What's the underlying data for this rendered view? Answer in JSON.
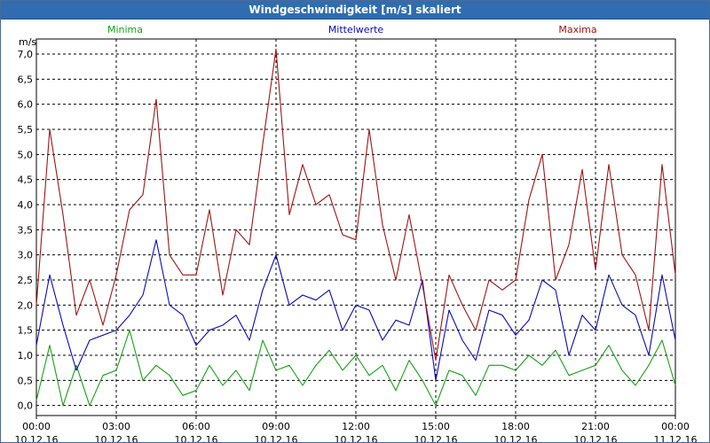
{
  "window": {
    "title": "Windgeschwindigkeit [m/s] skaliert"
  },
  "colors": {
    "Minima": "#16a216",
    "Mittelwerte": "#0a0ab8",
    "Maxima": "#a01414",
    "grid": "#000000",
    "titlebar": "#2f6db0"
  },
  "chart_data": {
    "type": "line",
    "title": "Windgeschwindigkeit [m/s] skaliert",
    "ylabel": "m/s",
    "xlabel": "",
    "ylim": [
      -0.2,
      7.3
    ],
    "xlim_hours": [
      0,
      24
    ],
    "grid": true,
    "legend": "top",
    "y_ticks": [
      "0,0",
      "0,5",
      "1,0",
      "1,5",
      "2,0",
      "2,5",
      "3,0",
      "3,5",
      "4,0",
      "4,5",
      "5,0",
      "5,5",
      "6,0",
      "6,5",
      "7,0"
    ],
    "x_ticks": [
      {
        "time": "00:00",
        "date": "10.12.16"
      },
      {
        "time": "03:00",
        "date": "10.12.16"
      },
      {
        "time": "06:00",
        "date": "10.12.16"
      },
      {
        "time": "09:00",
        "date": "10.12.16"
      },
      {
        "time": "12:00",
        "date": "10.12.16"
      },
      {
        "time": "15:00",
        "date": "10.12.16"
      },
      {
        "time": "18:00",
        "date": "10.12.16"
      },
      {
        "time": "21:00",
        "date": "10.12.16"
      },
      {
        "time": "00:00",
        "date": "11.12.16"
      }
    ],
    "x_hours": [
      0,
      0.5,
      1,
      1.5,
      2,
      2.5,
      3,
      3.5,
      4,
      4.5,
      5,
      5.5,
      6,
      6.5,
      7,
      7.5,
      8,
      8.5,
      9,
      9.5,
      10,
      10.5,
      11,
      11.5,
      12,
      12.5,
      13,
      13.5,
      14,
      14.5,
      15,
      15.5,
      16,
      16.5,
      17,
      17.5,
      18,
      18.5,
      19,
      19.5,
      20,
      20.5,
      21,
      21.5,
      22,
      22.5,
      23,
      23.5,
      24
    ],
    "series": [
      {
        "name": "Minima",
        "values": [
          0.1,
          1.2,
          0.0,
          0.8,
          0.0,
          0.6,
          0.7,
          1.5,
          0.5,
          0.8,
          0.6,
          0.2,
          0.3,
          0.8,
          0.4,
          0.7,
          0.3,
          1.3,
          0.7,
          0.8,
          0.4,
          0.8,
          1.1,
          0.7,
          1.0,
          0.6,
          0.8,
          0.3,
          0.9,
          0.5,
          0.0,
          0.7,
          0.6,
          0.2,
          0.8,
          0.8,
          0.7,
          1.0,
          0.8,
          1.1,
          0.6,
          0.7,
          0.8,
          1.2,
          0.7,
          0.4,
          0.8,
          1.3,
          0.4
        ]
      },
      {
        "name": "Mittelwerte",
        "values": [
          1.2,
          2.6,
          1.6,
          0.7,
          1.3,
          1.4,
          1.5,
          1.8,
          2.2,
          3.3,
          2.0,
          1.8,
          1.2,
          1.5,
          1.6,
          1.8,
          1.3,
          2.3,
          3.0,
          2.0,
          2.2,
          2.1,
          2.3,
          1.5,
          2.0,
          1.9,
          1.3,
          1.7,
          1.6,
          2.5,
          0.5,
          1.9,
          1.3,
          0.9,
          1.9,
          1.8,
          1.4,
          1.7,
          2.5,
          2.3,
          1.0,
          1.8,
          1.5,
          2.6,
          2.0,
          1.8,
          1.0,
          2.6,
          1.3
        ]
      },
      {
        "name": "Maxima",
        "values": [
          2.0,
          5.5,
          3.8,
          1.8,
          2.5,
          1.6,
          2.6,
          3.9,
          4.2,
          6.1,
          3.0,
          2.6,
          2.6,
          3.9,
          2.2,
          3.5,
          3.2,
          5.2,
          7.1,
          3.8,
          4.8,
          4.0,
          4.2,
          3.4,
          3.3,
          5.5,
          3.6,
          2.5,
          3.8,
          2.4,
          0.9,
          2.6,
          2.0,
          1.5,
          2.5,
          2.3,
          2.5,
          4.1,
          5.0,
          2.5,
          3.2,
          4.7,
          2.7,
          4.8,
          3.0,
          2.6,
          1.5,
          4.8,
          2.6
        ]
      }
    ]
  }
}
